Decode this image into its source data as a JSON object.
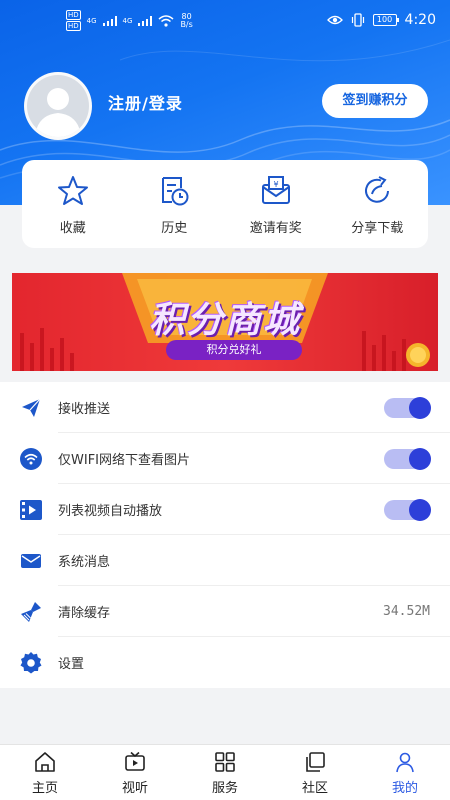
{
  "status_bar": {
    "sim1": "HD",
    "sim2": "HD",
    "net1": "4G",
    "net2": "4G",
    "speed_value": "80",
    "speed_unit": "B/s",
    "battery": "100",
    "time": "4:20"
  },
  "profile": {
    "login_label": "注册/登录",
    "signin_button": "签到赚积分"
  },
  "quick_actions": [
    {
      "label": "收藏",
      "icon": "star-icon"
    },
    {
      "label": "历史",
      "icon": "history-icon"
    },
    {
      "label": "邀请有奖",
      "icon": "invite-icon"
    },
    {
      "label": "分享下载",
      "icon": "share-icon"
    }
  ],
  "banner": {
    "title": "积分商城",
    "subtitle": "积分兑好礼"
  },
  "settings": [
    {
      "label": "接收推送",
      "icon": "send-icon",
      "toggle": true
    },
    {
      "label": "仅WIFI网络下查看图片",
      "icon": "wifi-icon",
      "toggle": true
    },
    {
      "label": "列表视频自动播放",
      "icon": "video-icon",
      "toggle": true
    },
    {
      "label": "系统消息",
      "icon": "mail-icon"
    },
    {
      "label": "清除缓存",
      "icon": "broom-icon",
      "value": "34.52M"
    },
    {
      "label": "设置",
      "icon": "gear-icon"
    }
  ],
  "tabs": [
    {
      "label": "主页",
      "icon": "home-icon"
    },
    {
      "label": "视听",
      "icon": "tv-icon"
    },
    {
      "label": "服务",
      "icon": "grid-icon"
    },
    {
      "label": "社区",
      "icon": "community-icon"
    },
    {
      "label": "我的",
      "icon": "user-icon",
      "active": true
    }
  ],
  "colors": {
    "header_blue": "#1474f2",
    "accent": "#2d3fd9",
    "tab_active": "#2d5be3",
    "banner_red": "#e3262e"
  }
}
